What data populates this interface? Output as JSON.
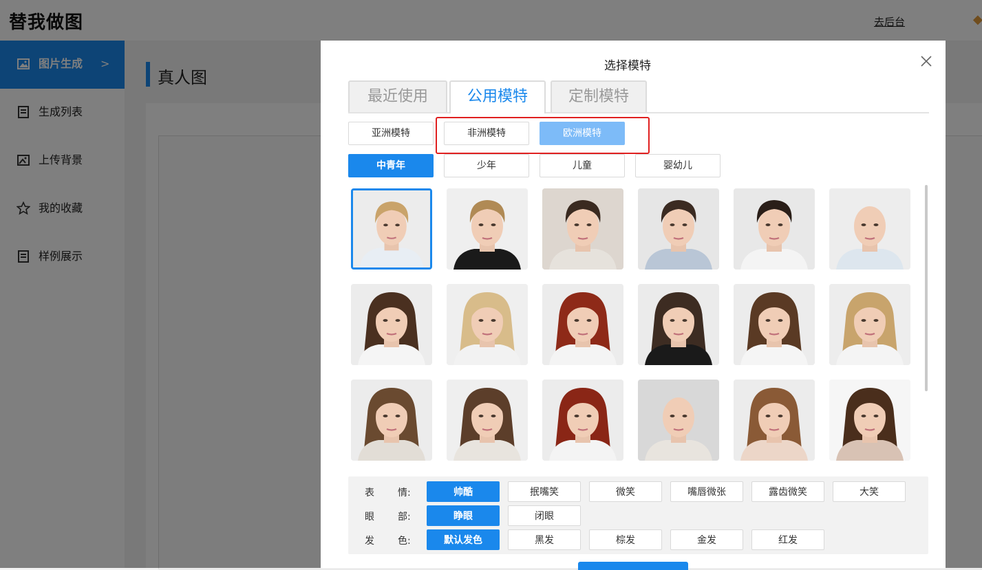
{
  "app": {
    "title": "替我做图",
    "admin_link": "去后台"
  },
  "sidebar": {
    "items": [
      {
        "label": "图片生成",
        "icon": "image-icon",
        "active": true
      },
      {
        "label": "生成列表",
        "icon": "list-icon"
      },
      {
        "label": "上传背景",
        "icon": "upload-image-icon"
      },
      {
        "label": "我的收藏",
        "icon": "star-icon"
      },
      {
        "label": "样例展示",
        "icon": "document-icon"
      }
    ]
  },
  "page": {
    "title": "真人图"
  },
  "modal": {
    "title": "选择模特",
    "tabs": [
      "最近使用",
      "公用模特",
      "定制模特"
    ],
    "active_tab": "公用模特",
    "regions": [
      "亚洲模特",
      "非洲模特",
      "欧洲模特"
    ],
    "selected_region": "欧洲模特",
    "ages": [
      "中青年",
      "少年",
      "儿童",
      "婴幼儿"
    ],
    "selected_age": "中青年",
    "models": [
      {
        "hair": "#c9a36a",
        "top": "#e8eef4",
        "bg": "#ececec",
        "gender": "m",
        "selected": true
      },
      {
        "hair": "#b08a55",
        "top": "#1a1a1a",
        "bg": "#efefef",
        "gender": "m"
      },
      {
        "hair": "#3a2a20",
        "top": "#e6e2dc",
        "bg": "#ddd6cf",
        "gender": "m"
      },
      {
        "hair": "#3b2b22",
        "top": "#b9c6d6",
        "bg": "#e6e6e6",
        "gender": "m"
      },
      {
        "hair": "#2a1e18",
        "top": "#f4f4f4",
        "bg": "#e8e8e8",
        "gender": "m"
      },
      {
        "hair": "none",
        "top": "#dde6ee",
        "bg": "#ededed",
        "gender": "m"
      },
      {
        "hair": "#4a3020",
        "top": "#f5f5f5",
        "bg": "#ececec",
        "gender": "f"
      },
      {
        "hair": "#d8bc8a",
        "top": "#f2f2f2",
        "bg": "#efefef",
        "gender": "f"
      },
      {
        "hair": "#8e2a18",
        "top": "#f4f4f4",
        "bg": "#ececec",
        "gender": "f"
      },
      {
        "hair": "#3d2c22",
        "top": "#1a1a1a",
        "bg": "#ebebeb",
        "gender": "f"
      },
      {
        "hair": "#5a3a24",
        "top": "#f5f5f5",
        "bg": "#ececec",
        "gender": "f"
      },
      {
        "hair": "#c8a46c",
        "top": "#f4f4f4",
        "bg": "#ededed",
        "gender": "f"
      },
      {
        "hair": "#6a4a30",
        "top": "#e2ddd6",
        "bg": "#ececec",
        "gender": "f"
      },
      {
        "hair": "#5c3e2a",
        "top": "#e8e4de",
        "bg": "#efefef",
        "gender": "f"
      },
      {
        "hair": "#8a2616",
        "top": "#f4f4f4",
        "bg": "#ececec",
        "gender": "f"
      },
      {
        "hair": "none",
        "top": "#e8e4de",
        "bg": "#d8d8d8",
        "gender": "f"
      },
      {
        "hair": "#8a5a36",
        "top": "#ecd6c8",
        "bg": "#ececec",
        "gender": "f"
      },
      {
        "hair": "#4a2e1c",
        "top": "#d8c2b4",
        "bg": "#f6f6f6",
        "gender": "f"
      }
    ],
    "attributes": [
      {
        "label": [
          "表",
          "情:"
        ],
        "options": [
          "帅酷",
          "抿嘴笑",
          "微笑",
          "嘴唇微张",
          "露齿微笑",
          "大笑"
        ],
        "selected": "帅酷"
      },
      {
        "label": [
          "眼",
          "部:"
        ],
        "options": [
          "睁眼",
          "闭眼"
        ],
        "selected": "睁眼"
      },
      {
        "label": [
          "发",
          "色:"
        ],
        "options": [
          "默认发色",
          "黑发",
          "棕发",
          "金发",
          "红发"
        ],
        "selected": "默认发色"
      }
    ],
    "colors": {
      "accent": "#1a88ec",
      "accent_light": "#7dbbf8",
      "highlight": "#e02020"
    }
  }
}
